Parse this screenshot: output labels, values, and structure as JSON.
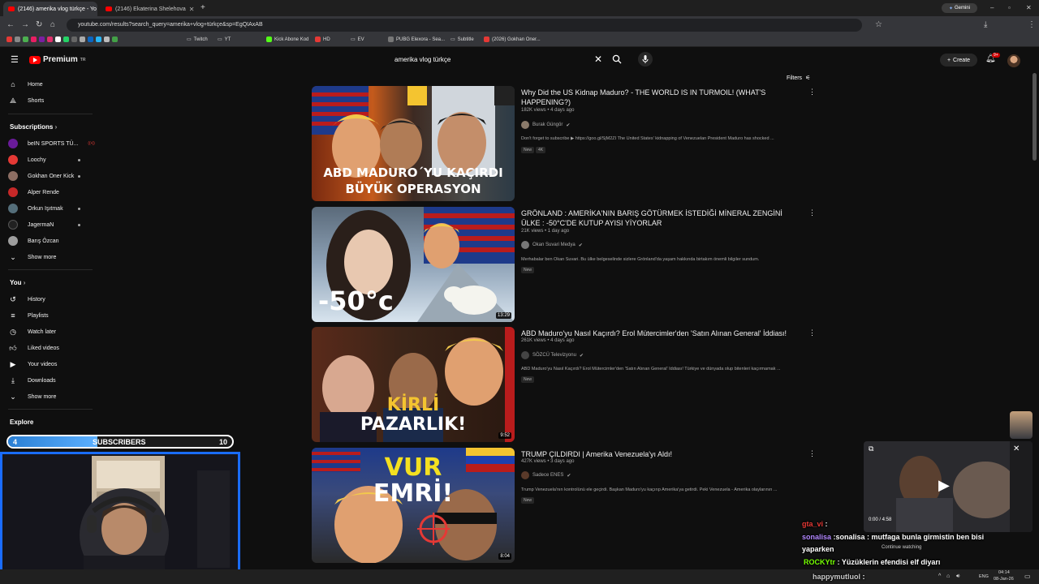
{
  "browser": {
    "tabs": [
      {
        "title": "(2146) amerika vlog türkçe - Yo",
        "active": true
      },
      {
        "title": "(2146) Ekaterina Shelehova",
        "active": false
      }
    ],
    "new_tab": "+",
    "gemini": "Gemini",
    "url": "youtube.com/results?search_query=amerika+vlog+türkçe&sp=EgQIAxAB",
    "bookmarks": [
      "Twitch",
      "YT",
      "Kick Abone Kod",
      "HD",
      "EV",
      "PUBG Elexora - Sea...",
      "Subtitle",
      "(2026) Gokhan Oner..."
    ]
  },
  "header": {
    "logo_text": "Premium",
    "logo_sup": "TR",
    "search_query": "amerika vlog türkçe",
    "create_label": "Create",
    "notif_count": "9+"
  },
  "sidebar": {
    "top": [
      {
        "label": "Home",
        "icon": "home-icon"
      },
      {
        "label": "Shorts",
        "icon": "shorts-icon"
      }
    ],
    "subscriptions_title": "Subscriptions",
    "subscriptions": [
      {
        "label": "beIN SPORTS TÜ...",
        "color": "#6a1b9a"
      },
      {
        "label": "Loochy",
        "color": "#e53935"
      },
      {
        "label": "Gokhan Oner Kick",
        "color": "#8d6e63"
      },
      {
        "label": "Alper Rende",
        "color": "#c62828"
      },
      {
        "label": "Orkun Işıtmak",
        "color": "#546e7a"
      },
      {
        "label": "JagermaN",
        "color": "#212121"
      },
      {
        "label": "Barış Özcan",
        "color": "#9e9e9e"
      }
    ],
    "show_more": "Show more",
    "you_title": "You",
    "you_items": [
      {
        "label": "History",
        "icon": "history-icon"
      },
      {
        "label": "Playlists",
        "icon": "playlists-icon"
      },
      {
        "label": "Watch later",
        "icon": "watch-later-icon"
      },
      {
        "label": "Liked videos",
        "icon": "liked-videos-icon"
      },
      {
        "label": "Your videos",
        "icon": "your-videos-icon"
      },
      {
        "label": "Downloads",
        "icon": "downloads-icon"
      }
    ],
    "explore_title": "Explore"
  },
  "filters_label": "Filters",
  "results": [
    {
      "title": "Why Did the US Kidnap Maduro? - THE WORLD IS IN TURMOIL! (WHAT'S HAPPENING?)",
      "meta": "182K views • 4 days ago",
      "channel": "Burak Güngör",
      "desc": "Don't forget to subscribe ▶ https://goo.gl/SjM2ZI The United States' kidnapping of Venezuelan President Maduro has shocked ...",
      "badges": [
        "New",
        "4K"
      ],
      "duration": "",
      "thumb_caption": [
        "ABD MADURO´YU KAÇIRDI",
        "BÜYÜK OPERASYON"
      ]
    },
    {
      "title": "GRÖNLAND : AMERİKA'NIN BARIŞ GÖTÜRMEK İSTEDİĞİ MİNERAL ZENGİNİ ÜLKE : -50°C'DE KUTUP AYISI YİYORLAR",
      "meta": "21K views • 1 day ago",
      "channel": "Okan Suvari Medya",
      "desc": "Merhabalar ben Okan Suvari. Bu ülke belgeselinde sizlere Grönland'da yaşam hakkında birtakım önemli bilgiler sundum.",
      "badges": [
        "New"
      ],
      "duration": "13:29",
      "thumb_caption": [
        "-50°c"
      ]
    },
    {
      "title": "ABD Maduro'yu Nasıl Kaçırdı? Erol Mütercimler'den 'Satın Alınan General' İddiası!",
      "meta": "261K views • 4 days ago",
      "channel": "SÖZCÜ Televizyonu",
      "desc": "ABD Maduro'yu Nasıl Kaçırdı? Erol Mütercimler'den 'Satın Alınan General' İddiası! Türkiye ve dünyada olup bitenleri kaçırmamak ...",
      "badges": [
        "New"
      ],
      "duration": "9:52",
      "thumb_caption": [
        "KİRLİ",
        "PAZARLIK!"
      ]
    },
    {
      "title": "TRUMP ÇILDIRDI | Amerika Venezuela'yı Aldı!",
      "meta": "427K views • 3 days ago",
      "channel": "Sadece ENES",
      "desc": "Trump Venezuela'nın kontrolünü ele geçirdi. Başkan Maduro'yu kaçırıp Amerika'ya getirdi. Peki Venezuela - Amerika olaylarının ...",
      "badges": [
        "New"
      ],
      "duration": "8:04",
      "thumb_caption": [
        "VUR",
        "EMRİ!"
      ]
    }
  ],
  "stream_overlay": {
    "subs_label": "SUBSCRIBERS",
    "subs_current": "4",
    "subs_goal": "10",
    "subs_progress": 0.4
  },
  "miniplayer": {
    "time": "0:00 / 4:58",
    "continue": "Continue watching"
  },
  "chat": [
    {
      "user": "gta_vi",
      "msg": ":",
      "color": "#e53935"
    },
    {
      "user": "sonalisa",
      "msg": ":sonalisa : mutfaga bunla girmistin ben bisi",
      "color": "#b388ff"
    },
    {
      "user": "",
      "msg": "yaparken",
      "color": "#fff"
    },
    {
      "user": "ROCKYtr",
      "msg": ": Yüzüklerin efendisi elf diyarı",
      "color": "#76ff03"
    },
    {
      "user": "happymutluol",
      "msg": ":",
      "color": "#cccccc"
    }
  ],
  "taskbar": {
    "lang": "ENG",
    "time": "04:14",
    "date": "08-Jan-26"
  }
}
